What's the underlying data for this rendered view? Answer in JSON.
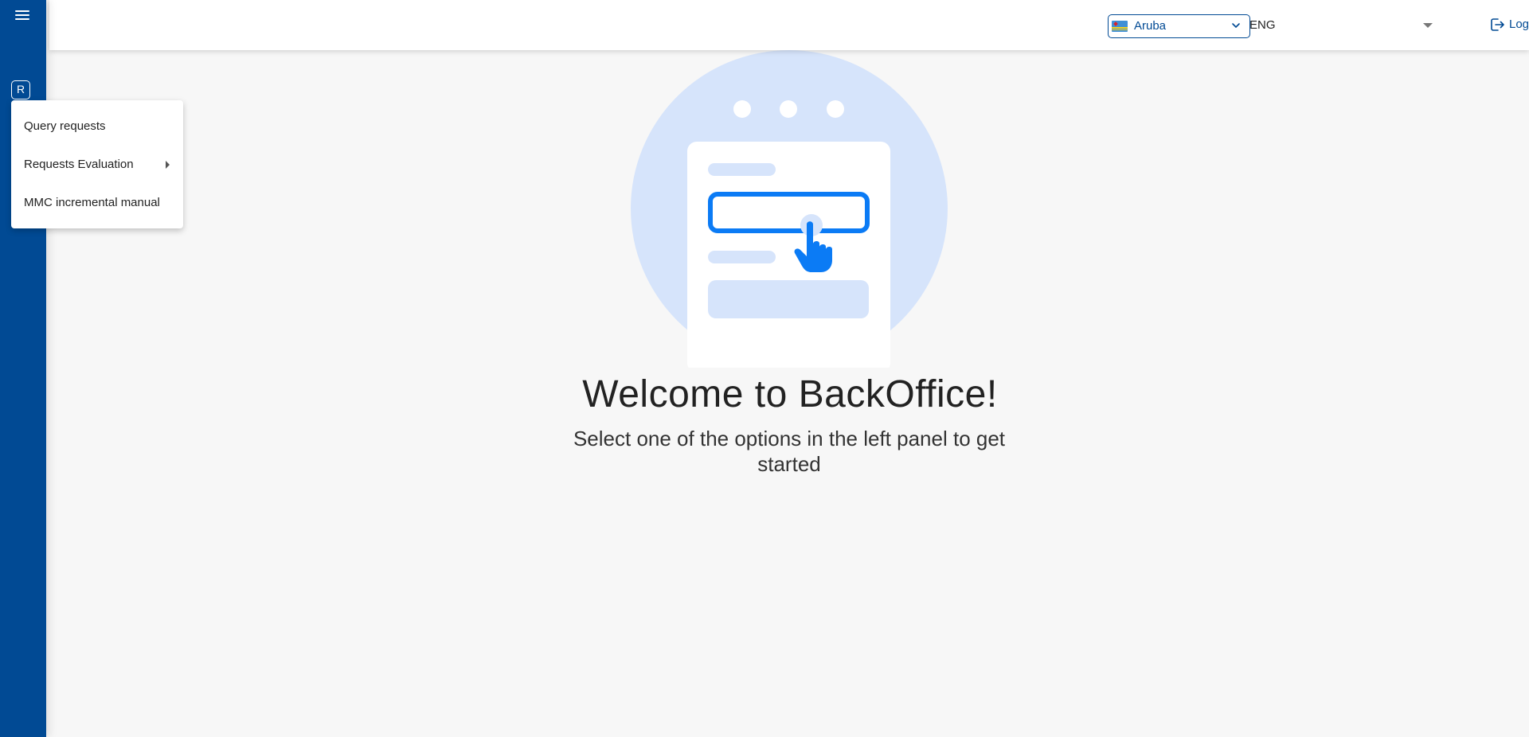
{
  "header": {
    "country_select": {
      "value": "Aruba",
      "flag_icon": "aruba-flag-icon"
    },
    "language_select": {
      "value": "ENG"
    },
    "logout_label": "Log out"
  },
  "sidebar": {
    "user_initial": "R"
  },
  "menu": {
    "items": [
      {
        "label": "Query requests",
        "has_submenu": false
      },
      {
        "label": "Requests Evaluation",
        "has_submenu": true
      },
      {
        "label": "MMC incremental manual",
        "has_submenu": false
      }
    ]
  },
  "main": {
    "title": "Welcome to BackOffice!",
    "subtitle": "Select one of the options in the left panel to get started"
  },
  "colors": {
    "brand": "#014a94",
    "accent": "#0b7bf5",
    "illustration_bg": "#d6e4fb"
  }
}
